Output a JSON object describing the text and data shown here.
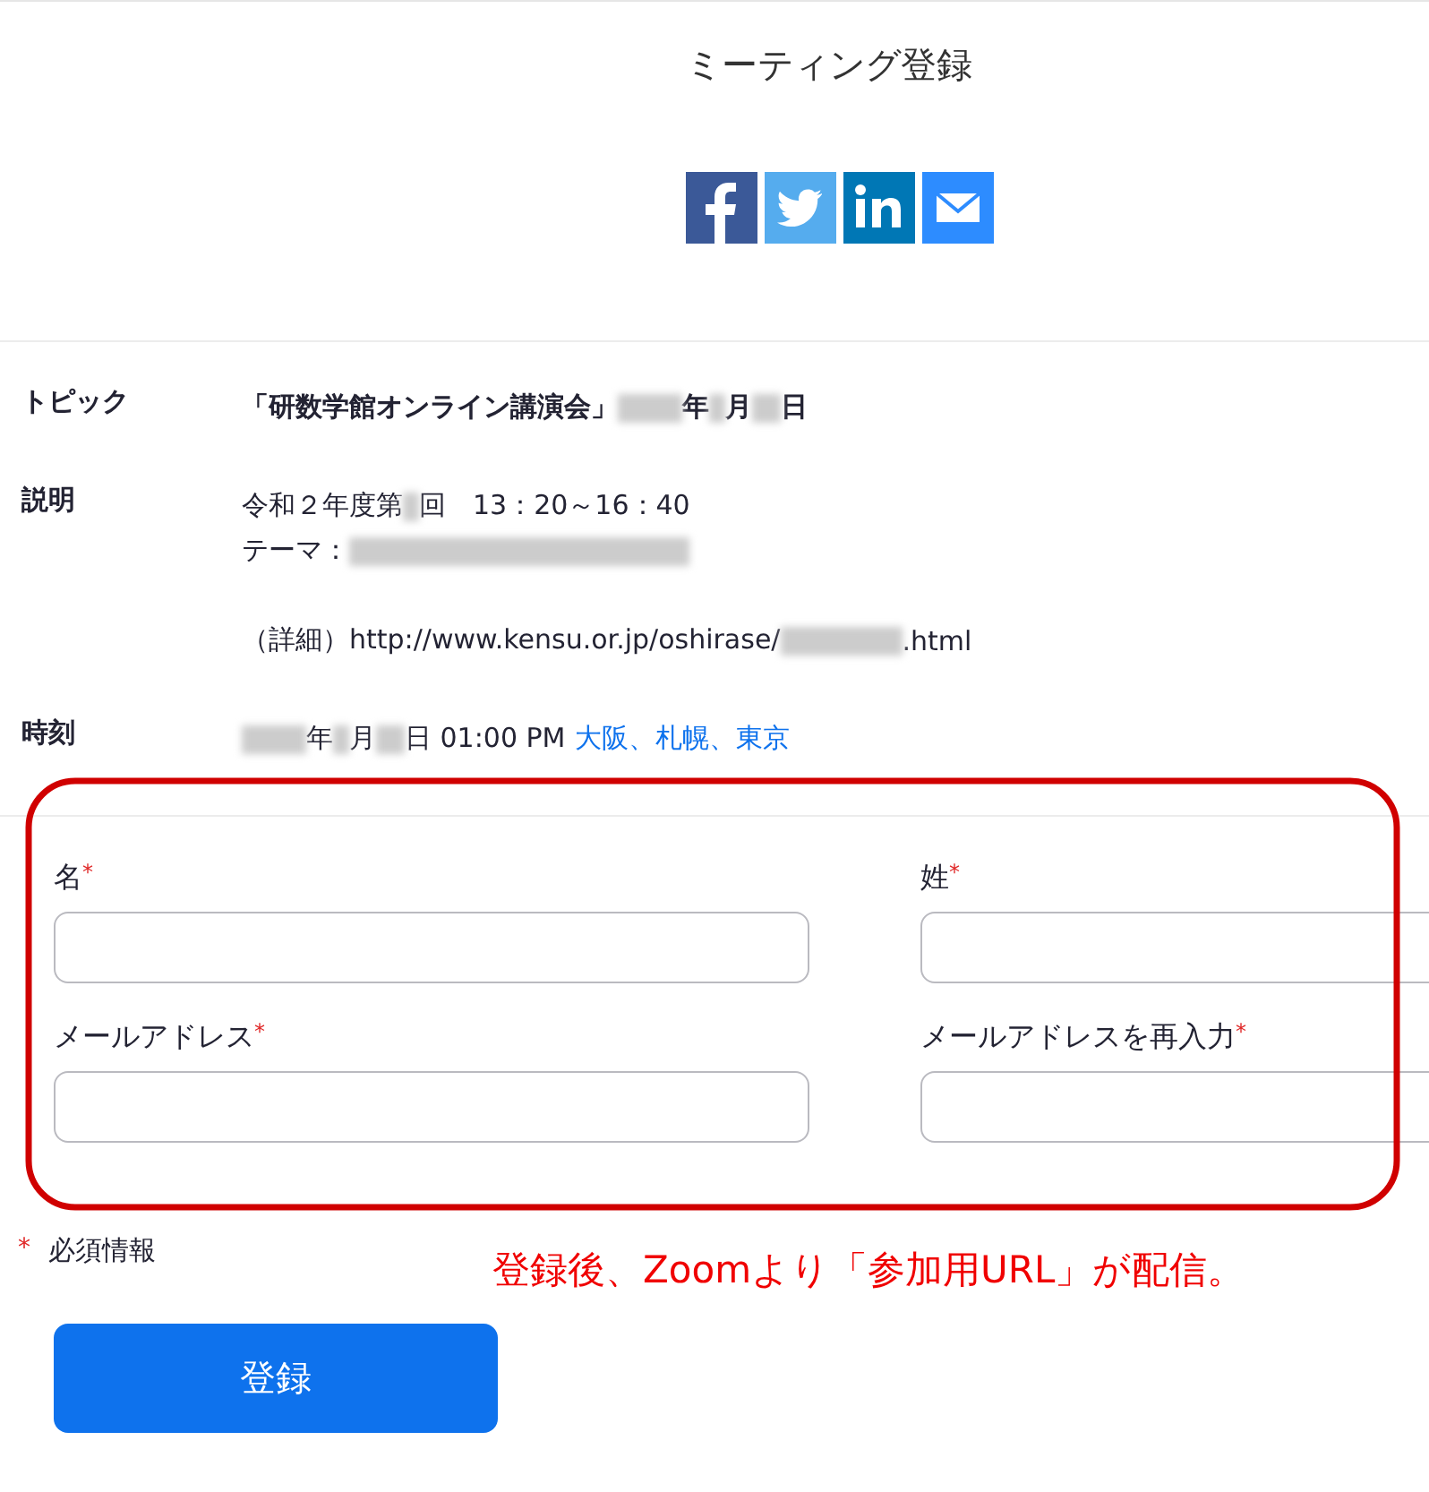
{
  "title": "ミーティング登録",
  "share_icons": [
    {
      "kind": "facebook"
    },
    {
      "kind": "twitter"
    },
    {
      "kind": "linkedin"
    },
    {
      "kind": "email"
    }
  ],
  "details": [
    {
      "label": "トピック",
      "bold": true,
      "paragraphs": [
        [
          [
            {
              "kind": "text",
              "text": "「研数学館オンライン講演会」"
            },
            {
              "kind": "blur-year"
            },
            {
              "kind": "text",
              "text": "年"
            },
            {
              "kind": "blur-digit"
            },
            {
              "kind": "text",
              "text": "月"
            },
            {
              "kind": "blur-day"
            },
            {
              "kind": "text",
              "text": "日"
            }
          ]
        ]
      ]
    },
    {
      "label": "説明",
      "bold": false,
      "paragraphs": [
        [
          [
            {
              "kind": "text",
              "text": "令和２年度第"
            },
            {
              "kind": "blur-digit"
            },
            {
              "kind": "text",
              "text": "回　13：20～16：40"
            }
          ],
          [
            {
              "kind": "text",
              "text": "テーマ："
            },
            {
              "kind": "blur-phrase"
            }
          ]
        ],
        [
          [
            {
              "kind": "text",
              "text": "（詳細）http://www.kensu.or.jp/oshirase/"
            },
            {
              "kind": "blur-code"
            },
            {
              "kind": "text",
              "text": ".html"
            }
          ]
        ]
      ]
    },
    {
      "label": "時刻",
      "bold": false,
      "paragraphs": [
        [
          [
            {
              "kind": "blur-year"
            },
            {
              "kind": "text",
              "text": "年"
            },
            {
              "kind": "blur-digit"
            },
            {
              "kind": "text",
              "text": "月"
            },
            {
              "kind": "blur-day"
            },
            {
              "kind": "text",
              "text": "日 01:00 PM"
            },
            {
              "kind": "link",
              "text": "大阪、札幌、東京"
            }
          ]
        ]
      ]
    }
  ],
  "fields": [
    {
      "label": "名",
      "required_mark": "*"
    },
    {
      "label": "姓",
      "required_mark": "*"
    },
    {
      "label": "メールアドレス",
      "required_mark": "*"
    },
    {
      "label": "メールアドレスを再入力",
      "required_mark": "*"
    }
  ],
  "required_note": {
    "mark": "*",
    "text": "必須情報"
  },
  "annotation": "登録後、Zoomより「参加用URL」が配信。",
  "submit_button": "登録"
}
